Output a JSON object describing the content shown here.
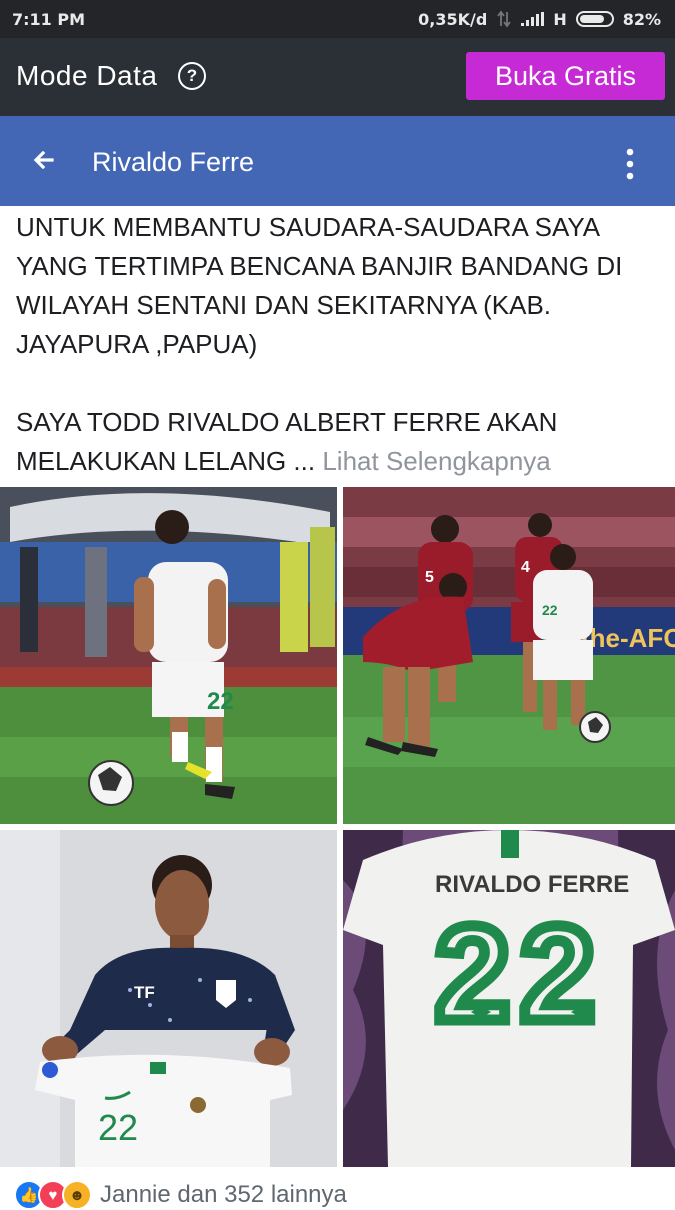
{
  "status_bar": {
    "time": "7:11 PM",
    "speed": "0,35K/d",
    "network": "H",
    "battery": "82%",
    "battery_level": 0.82
  },
  "data_mode_bar": {
    "title": "Mode Data",
    "help_icon": "?",
    "button_label": "Buka Gratis",
    "button_color": "#c62ad4"
  },
  "nav": {
    "back_icon": "arrow-left-icon",
    "title": "Rivaldo Ferre",
    "more_icon": "vertical-dots-icon",
    "color": "#4367b4"
  },
  "post": {
    "text_para1": "UNTUK MEMBANTU SAUDARA-SAUDARA SAYA YANG TERTIMPA BENCANA BANJIR BANDANG DI WILAYAH SENTANI  DAN SEKITARNYA (KAB. JAYAPURA ,PAPUA)",
    "text_para2": "SAYA TODD RIVALDO ALBERT FERRE AKAN MELAKUKAN LELANG ...",
    "see_more": "Lihat Selengkapnya"
  },
  "photos": {
    "p1_jersey_number": "22",
    "p2_jersey_number": "22",
    "p2_opponent_number_a": "5",
    "p2_opponent_number_b": "4",
    "p2_board_text": "the-AFC",
    "p3_shirt_text": "TF",
    "p3_jersey_number": "22",
    "p4_jersey_name": "RIVALDO FERRE",
    "p4_jersey_number": "22"
  },
  "reactions": {
    "icons": [
      "like-reaction-icon",
      "love-reaction-icon",
      "haha-reaction-icon"
    ],
    "summary": "Jannie dan 352 lainnya"
  }
}
